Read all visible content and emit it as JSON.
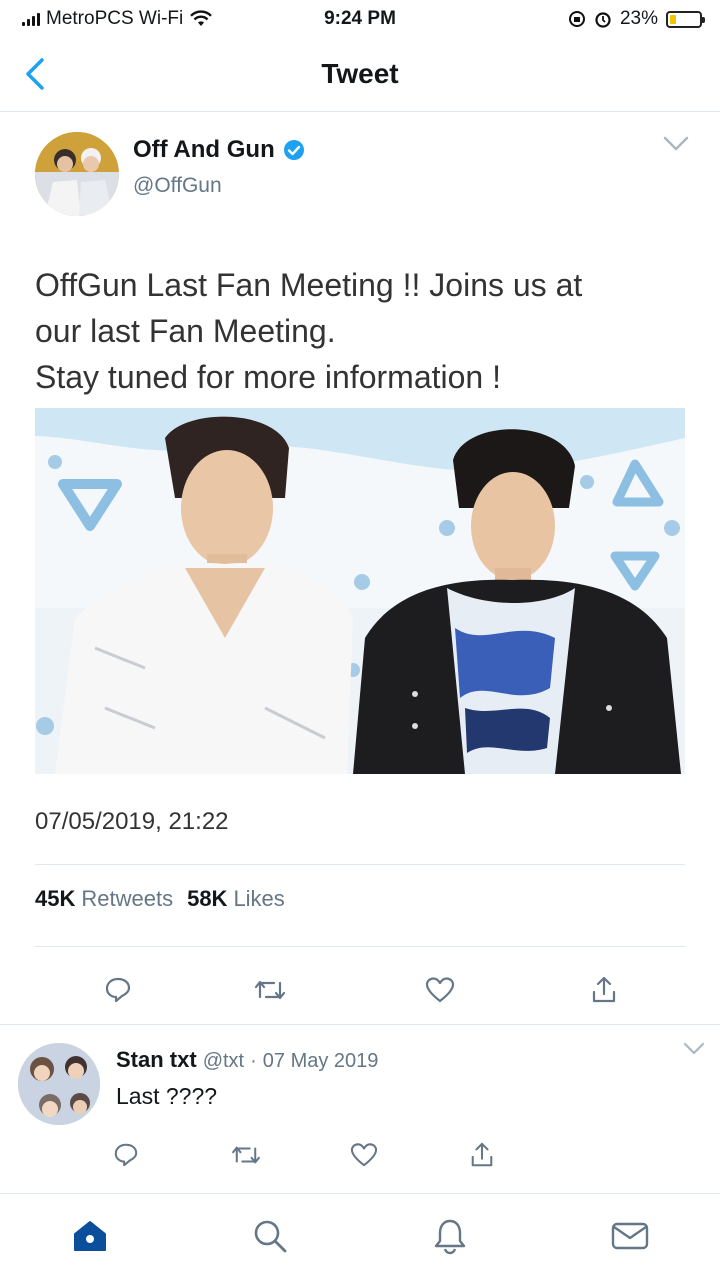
{
  "status_bar": {
    "carrier": "MetroPCS Wi-Fi",
    "time": "9:24 PM",
    "battery": "23%",
    "battery_level": 0.23
  },
  "header": {
    "title": "Tweet"
  },
  "tweet": {
    "author_name": "Off And Gun",
    "author_handle": "@OffGun",
    "text": "OffGun Last Fan Meeting !! Joins us at\nour last Fan Meeting.\nStay tuned for more information !",
    "timestamp": "07/05/2019, 21:22",
    "retweets": "45K",
    "retweets_label": "Retweets",
    "likes": "58K",
    "likes_label": "Likes"
  },
  "reply": {
    "name": "Stan txt",
    "handle": "@txt",
    "separator": "·",
    "date": "07 May 2019",
    "text": "Last ????"
  },
  "colors": {
    "accent": "#1da1f2",
    "text": "#14171a",
    "secondary": "#657786",
    "tabbar_icon": "#0b4f9c"
  },
  "tabbar": {
    "items": [
      "home-icon",
      "search-icon",
      "notifications-icon",
      "messages-icon"
    ]
  }
}
